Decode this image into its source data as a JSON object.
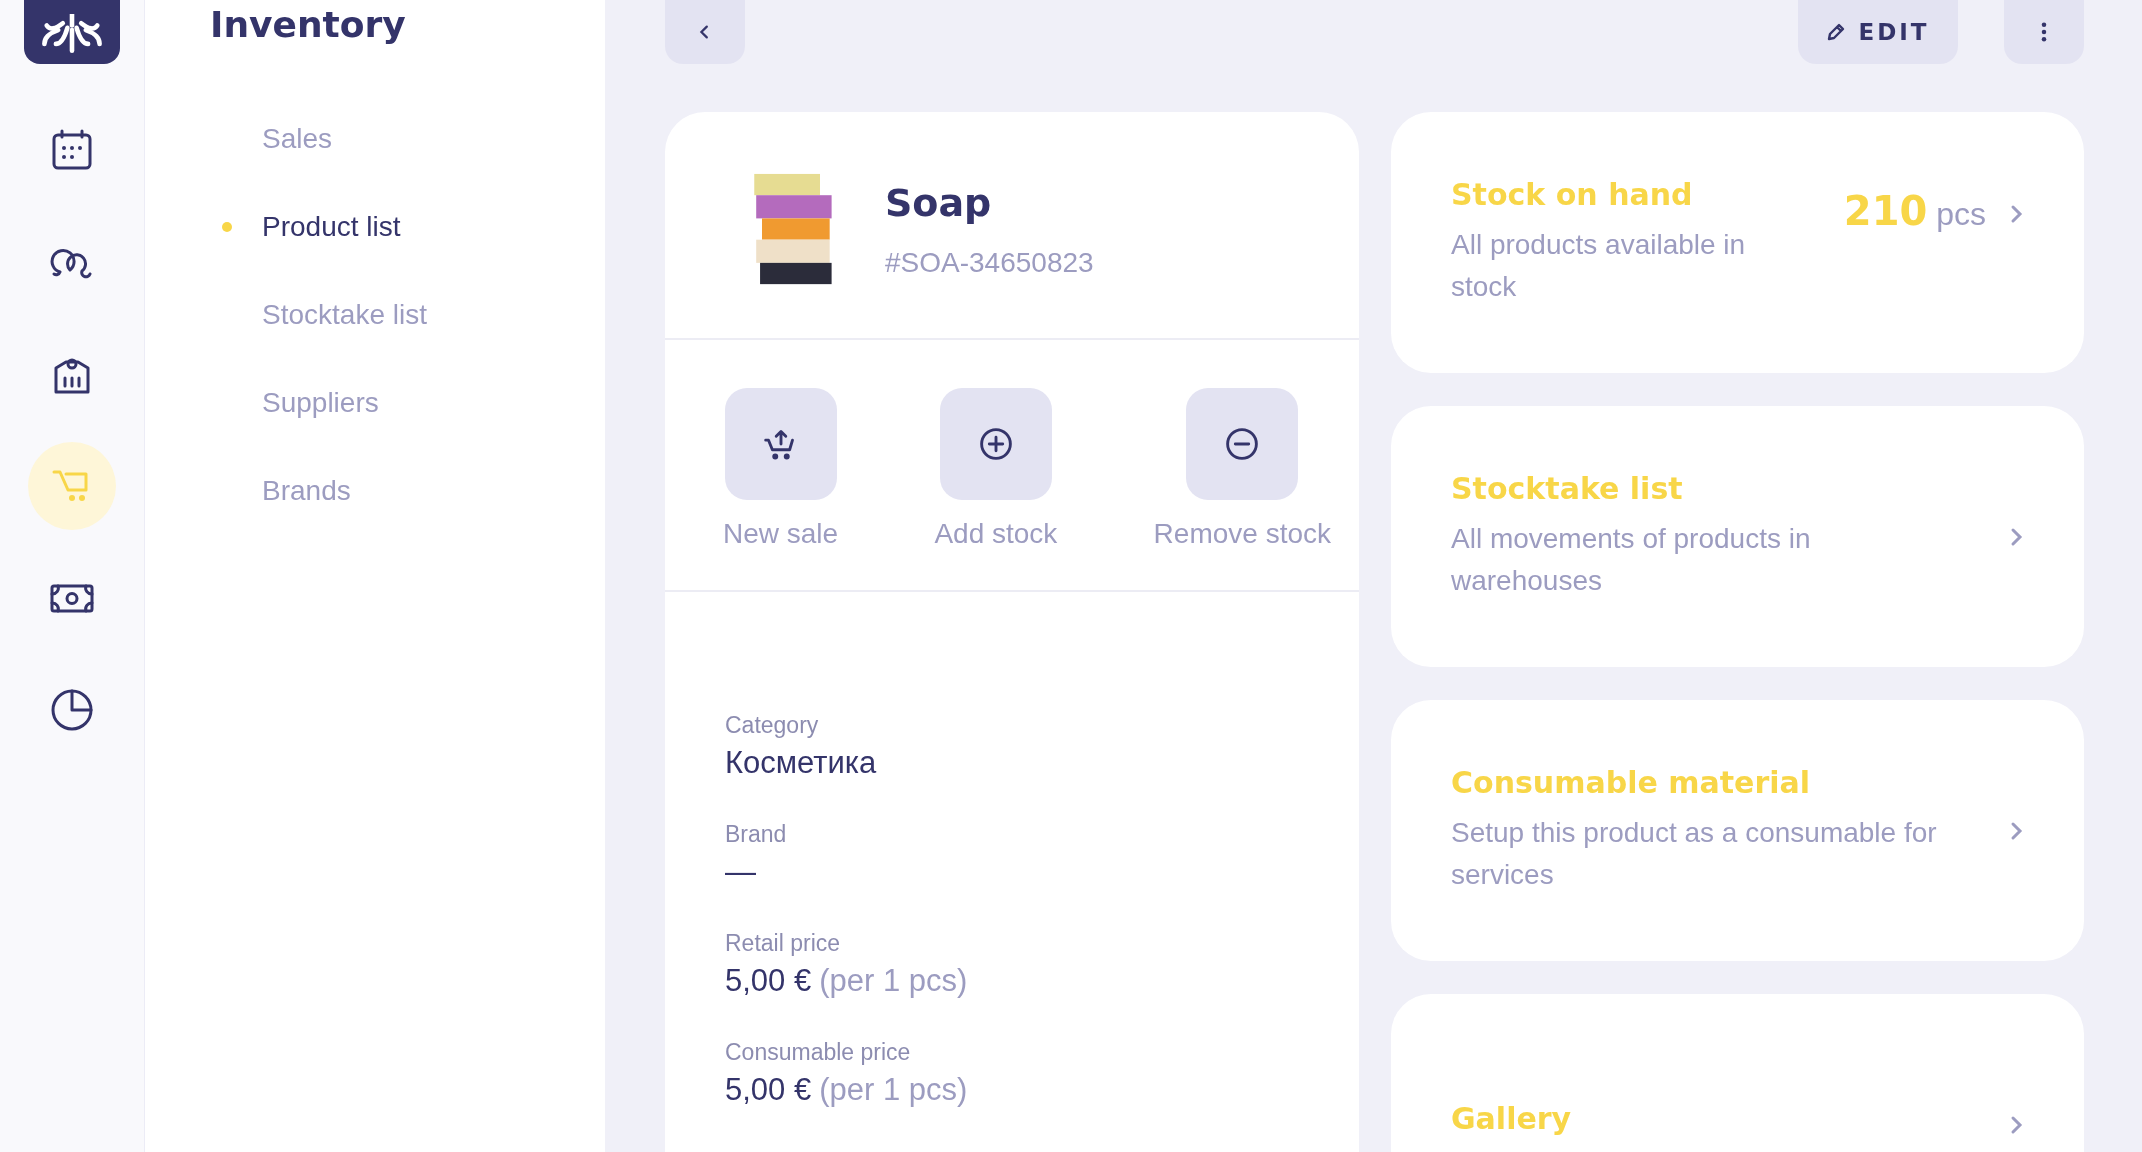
{
  "rail": {
    "items": [
      {
        "kind": "calendar",
        "selected": false
      },
      {
        "kind": "clients",
        "selected": false
      },
      {
        "kind": "catalog",
        "selected": false
      },
      {
        "kind": "cart",
        "selected": true
      },
      {
        "kind": "money",
        "selected": false
      },
      {
        "kind": "chart",
        "selected": false
      }
    ]
  },
  "sidebar": {
    "title": "Inventory",
    "items": [
      {
        "label": "Sales",
        "selected": false
      },
      {
        "label": "Product list",
        "selected": true
      },
      {
        "label": "Stocktake list",
        "selected": false
      },
      {
        "label": "Suppliers",
        "selected": false
      },
      {
        "label": "Brands",
        "selected": false
      }
    ]
  },
  "toolbar": {
    "edit_button": "EDIT"
  },
  "product": {
    "name": "Soap",
    "sku": "#SOA-34650823",
    "actions": [
      {
        "kind": "sale",
        "label": "New sale"
      },
      {
        "kind": "add",
        "label": "Add stock"
      },
      {
        "kind": "remove",
        "label": "Remove stock"
      }
    ],
    "details": [
      {
        "label": "Category",
        "value": "Косметика"
      },
      {
        "label": "Brand",
        "value": "—"
      },
      {
        "label": "Retail price",
        "value": "5,00 €",
        "note": "(per 1 pcs)"
      },
      {
        "label": "Consumable price",
        "value": "5,00 €",
        "note": "(per 1 pcs)"
      }
    ]
  },
  "cards": [
    {
      "title": "Stock on hand",
      "description": "All products available in stock",
      "count": "210",
      "unit": "pcs"
    },
    {
      "title": "Stocktake list",
      "description": "All movements of products in warehouses"
    },
    {
      "title": "Consumable material",
      "description": "Setup this product as a consumable for services"
    },
    {
      "title": "Gallery"
    }
  ]
}
